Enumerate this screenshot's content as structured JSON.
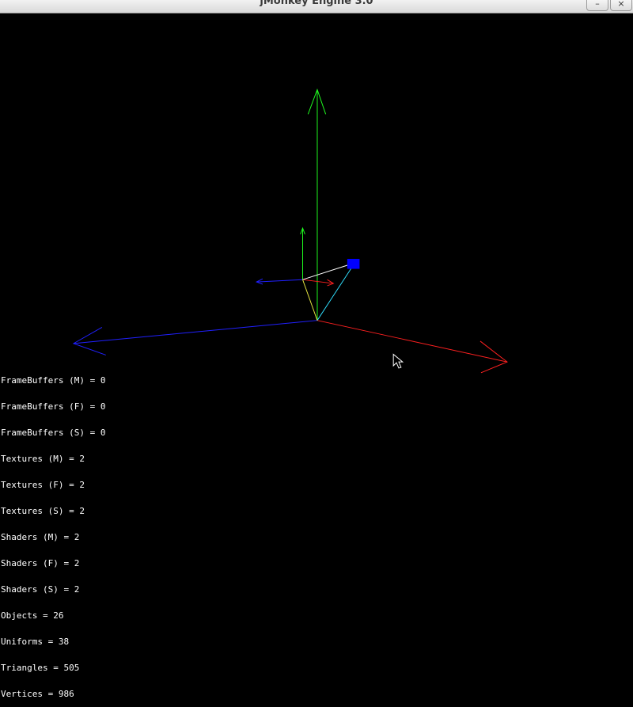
{
  "window": {
    "title": "jMonkey Engine 3.0",
    "minimize_label": "–",
    "close_label": "×"
  },
  "stats": [
    "FrameBuffers (M) = 0",
    "FrameBuffers (F) = 0",
    "FrameBuffers (S) = 0",
    "Textures (M) = 2",
    "Textures (F) = 2",
    "Textures (S) = 2",
    "Shaders (M) = 2",
    "Shaders (F) = 2",
    "Shaders (S) = 2",
    "Objects = 26",
    "Uniforms = 38",
    "Triangles = 505",
    "Vertices = 986"
  ],
  "colors": {
    "x_axis": "#ff2020",
    "y_axis": "#20ff20",
    "z_axis": "#2020ff",
    "box": "#0000ff",
    "link_white": "#ffffff",
    "link_cyan": "#30e0ff",
    "link_yellow": "#e6e640"
  }
}
